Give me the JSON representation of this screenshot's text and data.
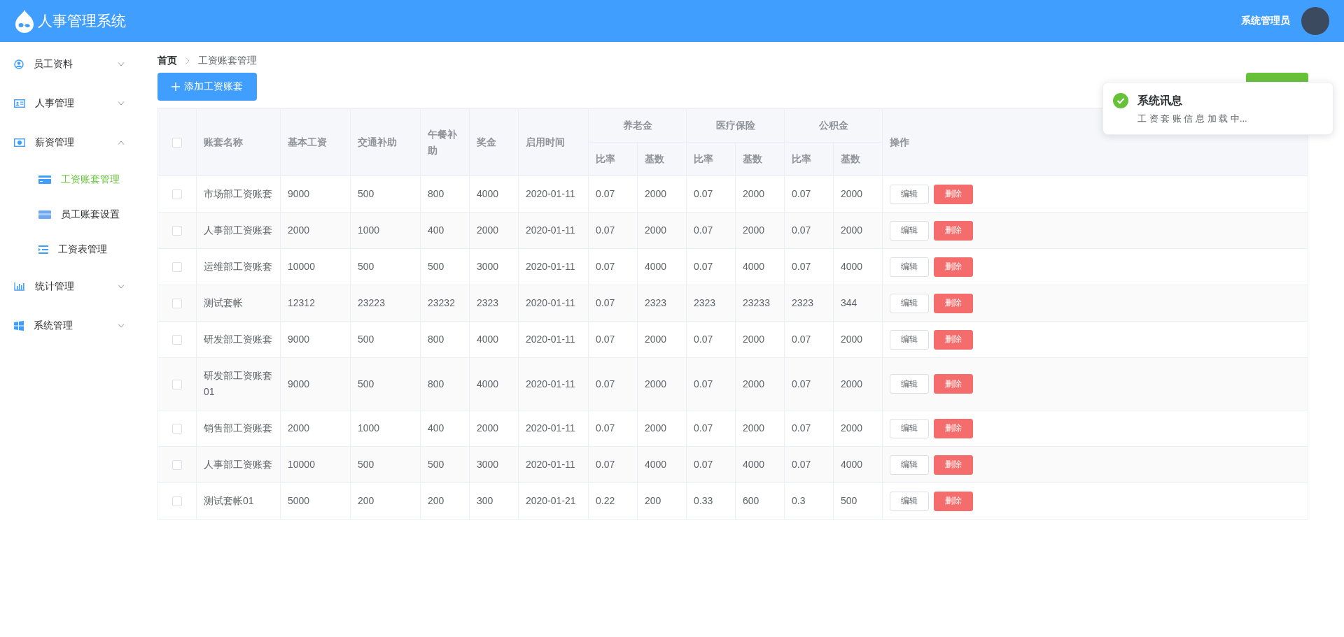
{
  "header": {
    "title": "人事管理系统",
    "user": "系统管理员"
  },
  "sidebar": {
    "items": [
      {
        "label": "员工资料",
        "expanded": false
      },
      {
        "label": "人事管理",
        "expanded": false
      },
      {
        "label": "薪资管理",
        "expanded": true,
        "children": [
          {
            "label": "工资账套管理",
            "selected": true
          },
          {
            "label": "员工账套设置",
            "selected": false
          },
          {
            "label": "工资表管理",
            "selected": false
          }
        ]
      },
      {
        "label": "统计管理",
        "expanded": false
      },
      {
        "label": "系统管理",
        "expanded": false
      }
    ]
  },
  "breadcrumb": [
    "首页",
    "工资账套管理"
  ],
  "toolbar": {
    "add_button": "添加工资账套"
  },
  "table": {
    "header_checked": false,
    "columns": [
      "账套名称",
      "基本工资",
      "交通补助",
      "午餐补助",
      "奖金",
      "启用时间"
    ],
    "groups": [
      {
        "label": "养老金",
        "sub": [
          "比率",
          "基数"
        ]
      },
      {
        "label": "医疗保险",
        "sub": [
          "比率",
          "基数"
        ]
      },
      {
        "label": "公积金",
        "sub": [
          "比率",
          "基数"
        ]
      }
    ],
    "action_column": "操作",
    "rows": [
      {
        "checked": false,
        "cells": [
          "市场部工资账套",
          "9000",
          "500",
          "800",
          "4000",
          "2020-01-11",
          "0.07",
          "2000",
          "0.07",
          "2000",
          "0.07",
          "2000"
        ],
        "actions": [
          "编辑",
          "删除"
        ]
      },
      {
        "checked": false,
        "cells": [
          "人事部工资账套",
          "2000",
          "1000",
          "400",
          "2000",
          "2020-01-11",
          "0.07",
          "2000",
          "0.07",
          "2000",
          "0.07",
          "2000"
        ],
        "actions": [
          "编辑",
          "删除"
        ]
      },
      {
        "checked": false,
        "cells": [
          "运维部工资账套",
          "10000",
          "500",
          "500",
          "3000",
          "2020-01-11",
          "0.07",
          "4000",
          "0.07",
          "4000",
          "0.07",
          "4000"
        ],
        "actions": [
          "编辑",
          "删除"
        ]
      },
      {
        "checked": false,
        "cells": [
          "测试套帐",
          "12312",
          "23223",
          "23232",
          "2323",
          "2020-01-11",
          "0.07",
          "2323",
          "2323",
          "23233",
          "2323",
          "344"
        ],
        "actions": [
          "编辑",
          "删除"
        ]
      },
      {
        "checked": false,
        "cells": [
          "研发部工资账套",
          "9000",
          "500",
          "800",
          "4000",
          "2020-01-11",
          "0.07",
          "2000",
          "0.07",
          "2000",
          "0.07",
          "2000"
        ],
        "actions": [
          "编辑",
          "删除"
        ]
      },
      {
        "checked": false,
        "cells": [
          "研发部工资账套01",
          "9000",
          "500",
          "800",
          "4000",
          "2020-01-11",
          "0.07",
          "2000",
          "0.07",
          "2000",
          "0.07",
          "2000"
        ],
        "actions": [
          "编辑",
          "删除"
        ]
      },
      {
        "checked": false,
        "cells": [
          "销售部工资账套",
          "2000",
          "1000",
          "400",
          "2000",
          "2020-01-11",
          "0.07",
          "2000",
          "0.07",
          "2000",
          "0.07",
          "2000"
        ],
        "actions": [
          "编辑",
          "删除"
        ]
      },
      {
        "checked": false,
        "cells": [
          "人事部工资账套",
          "10000",
          "500",
          "500",
          "3000",
          "2020-01-11",
          "0.07",
          "4000",
          "0.07",
          "4000",
          "0.07",
          "4000"
        ],
        "actions": [
          "编辑",
          "删除"
        ]
      },
      {
        "checked": false,
        "cells": [
          "测试套帐01",
          "5000",
          "200",
          "200",
          "300",
          "2020-01-21",
          "0.22",
          "200",
          "0.33",
          "600",
          "0.3",
          "500"
        ],
        "actions": [
          "编辑",
          "删除"
        ]
      }
    ]
  },
  "notification": {
    "kind": "success",
    "title": "系统讯息",
    "message": "工 资 套 账 信 息 加 载 中..."
  }
}
